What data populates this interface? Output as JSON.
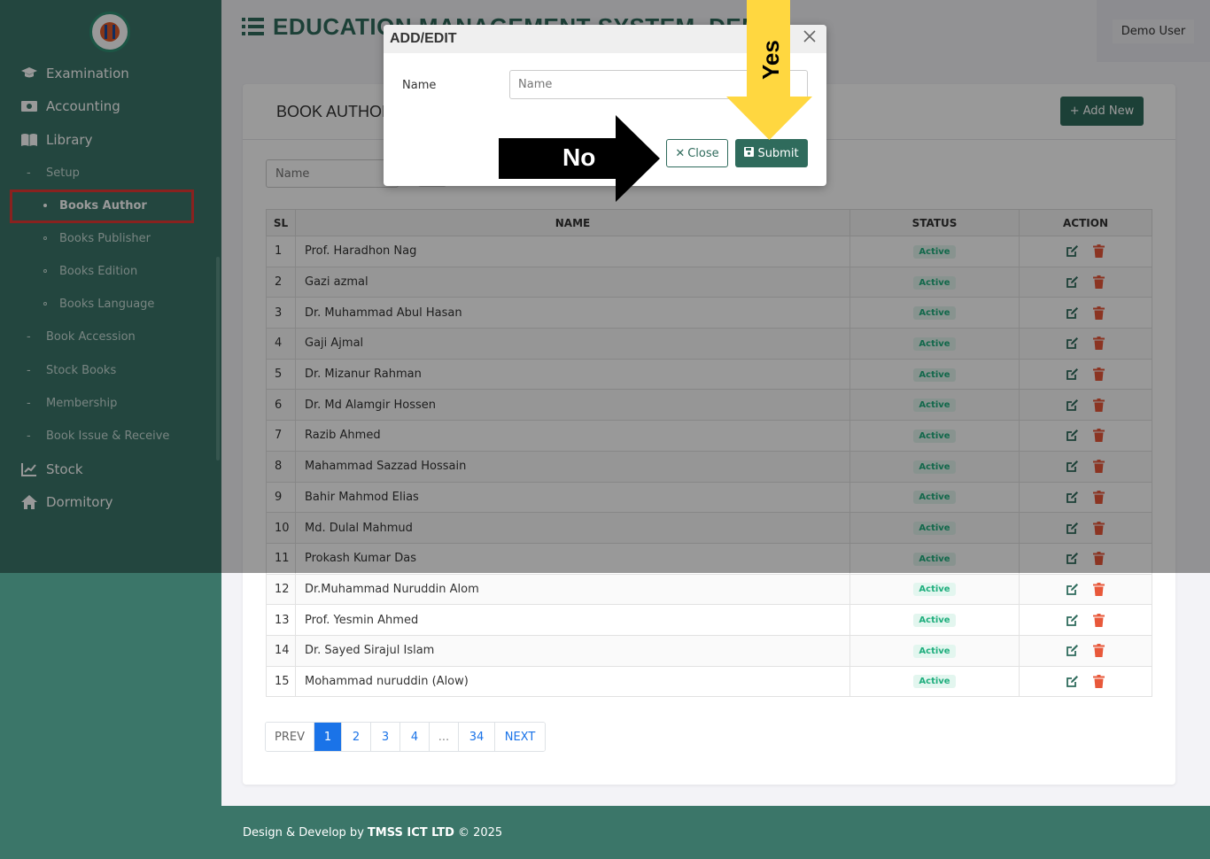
{
  "app": {
    "title": "EDUCATION MANAGEMENT SYSTEM, DEMO",
    "user": "Demo User"
  },
  "sidebar": {
    "items": [
      {
        "label": "Examination",
        "icon": "graduation-cap-icon"
      },
      {
        "label": "Accounting",
        "icon": "money-icon"
      },
      {
        "label": "Library",
        "icon": "book-icon"
      },
      {
        "label": "Stock",
        "icon": "chart-line-icon"
      },
      {
        "label": "Dormitory",
        "icon": "home-icon"
      }
    ],
    "library_sub": [
      "Setup",
      "Book Accession",
      "Stock Books",
      "Membership",
      "Book Issue & Receive"
    ],
    "setup_sub": [
      "Books Author",
      "Books Publisher",
      "Books Edition",
      "Books Language"
    ]
  },
  "card": {
    "title": "BOOK AUTHOR",
    "add_new_label": "Add New",
    "search_placeholder": "Name"
  },
  "table": {
    "headers": {
      "sl": "SL",
      "name": "NAME",
      "status": "STATUS",
      "action": "ACTION"
    },
    "rows": [
      {
        "sl": "1",
        "name": "Prof. Haradhon Nag",
        "status": "Active"
      },
      {
        "sl": "2",
        "name": "Gazi azmal",
        "status": "Active"
      },
      {
        "sl": "3",
        "name": "Dr. Muhammad Abul Hasan",
        "status": "Active"
      },
      {
        "sl": "4",
        "name": "Gaji Ajmal",
        "status": "Active"
      },
      {
        "sl": "5",
        "name": "Dr. Mizanur Rahman",
        "status": "Active"
      },
      {
        "sl": "6",
        "name": "Dr. Md Alamgir Hossen",
        "status": "Active"
      },
      {
        "sl": "7",
        "name": "Razib Ahmed",
        "status": "Active"
      },
      {
        "sl": "8",
        "name": "Mahammad Sazzad Hossain",
        "status": "Active"
      },
      {
        "sl": "9",
        "name": "Bahir Mahmod Elias",
        "status": "Active"
      },
      {
        "sl": "10",
        "name": "Md. Dulal Mahmud",
        "status": "Active"
      },
      {
        "sl": "11",
        "name": "Prokash Kumar Das",
        "status": "Active"
      },
      {
        "sl": "12",
        "name": "Dr.Muhammad Nuruddin Alom",
        "status": "Active"
      },
      {
        "sl": "13",
        "name": "Prof. Yesmin Ahmed",
        "status": "Active"
      },
      {
        "sl": "14",
        "name": "Dr. Sayed Sirajul Islam",
        "status": "Active"
      },
      {
        "sl": "15",
        "name": "Mohammad nuruddin (Alow)",
        "status": "Active"
      }
    ]
  },
  "pagination": {
    "prev": "PREV",
    "pages": [
      "1",
      "2",
      "3",
      "4",
      "...",
      "34"
    ],
    "next": "NEXT",
    "current": "1"
  },
  "footer": {
    "prefix": "Design & Develop by",
    "company": "TMSS ICT LTD",
    "suffix": "© 2025"
  },
  "modal": {
    "title": "ADD/EDIT",
    "name_label": "Name",
    "name_placeholder": "Name",
    "close_label": "Close",
    "submit_label": "Submit"
  },
  "annotations": {
    "no": "No",
    "yes": "Yes"
  },
  "colors": {
    "brand": "#2f6b5c",
    "sidebar": "#3b7669",
    "danger": "#e8583a",
    "accent": "#1a73e8"
  }
}
